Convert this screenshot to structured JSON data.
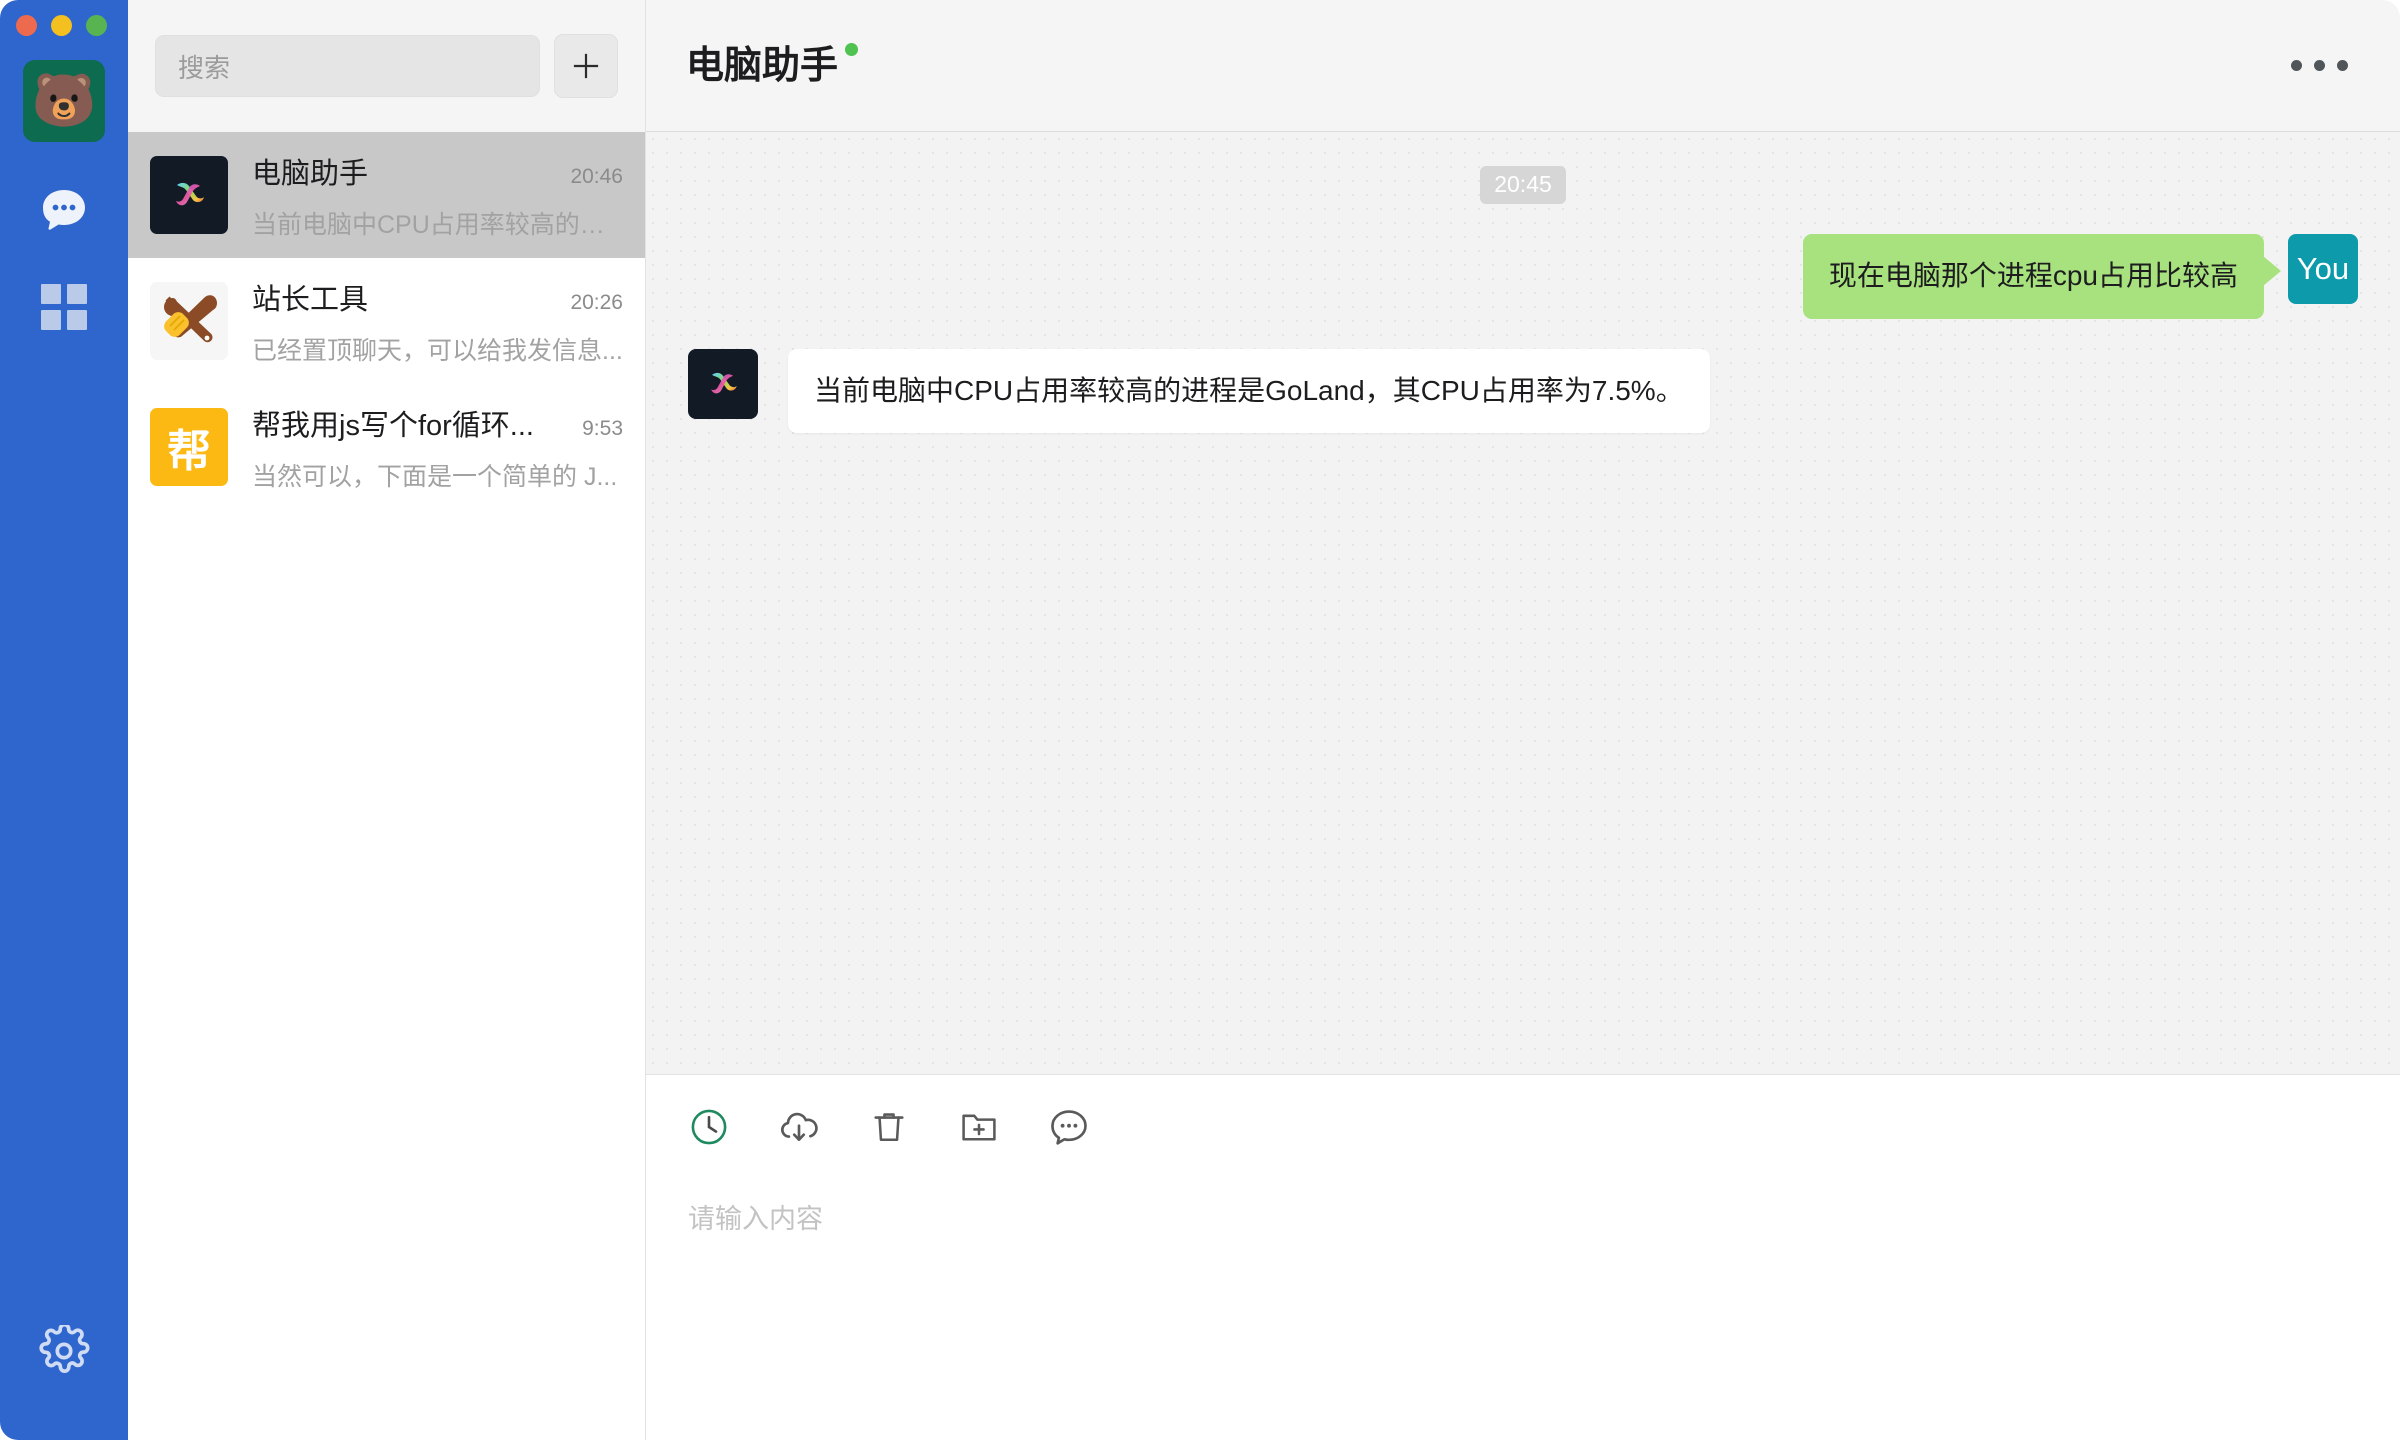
{
  "window": {
    "traffic_lights": [
      {
        "name": "close",
        "color": "#ee6a4e"
      },
      {
        "name": "minimize",
        "color": "#f4c020"
      },
      {
        "name": "zoom",
        "color": "#58b451"
      }
    ]
  },
  "rail": {
    "account_avatar_glyph": "🐻",
    "items": [
      {
        "name": "chats",
        "icon": "chat-bubble-icon",
        "active": true
      },
      {
        "name": "apps",
        "icon": "grid-icon",
        "active": false
      }
    ],
    "settings": {
      "icon": "gear-icon",
      "label": "设置"
    }
  },
  "search": {
    "placeholder": "搜索",
    "value": "",
    "add_button_label": "+"
  },
  "chat_list": [
    {
      "avatar_type": "copilot",
      "avatar_text": "",
      "title": "电脑助手",
      "time": "20:46",
      "preview": "当前电脑中CPU占用率较高的进...",
      "active": true
    },
    {
      "avatar_type": "tools",
      "avatar_text": "🛠",
      "title": "站长工具",
      "time": "20:26",
      "preview": "已经置顶聊天，可以给我发信息...",
      "active": false
    },
    {
      "avatar_type": "letter",
      "avatar_text": "帮",
      "title": "帮我用js写个for循环...",
      "time": "9:53",
      "preview": "当然可以，下面是一个简单的 J...",
      "active": false
    }
  ],
  "conversation": {
    "title": "电脑助手",
    "online": true,
    "online_color": "#4fc24f",
    "more_menu_label": "···",
    "timestamp_divider": "20:45",
    "messages": [
      {
        "side": "out",
        "avatar_label": "You",
        "avatar_color": "#0d9aab",
        "bubble_color": "#a8e27f",
        "text": "现在电脑那个进程cpu占用比较高"
      },
      {
        "side": "in",
        "avatar_label": "",
        "avatar_color": "#121a26",
        "bubble_color": "#ffffff",
        "text": "当前电脑中CPU占用率较高的进程是GoLand，其CPU占用率为7.5%。"
      }
    ]
  },
  "composer": {
    "tools": [
      {
        "name": "history-clock-icon",
        "label": "历史记录",
        "accent": "#1f8a5f"
      },
      {
        "name": "cloud-download-icon",
        "label": "下载"
      },
      {
        "name": "trash-icon",
        "label": "清空"
      },
      {
        "name": "folder-add-icon",
        "label": "新建文件夹"
      },
      {
        "name": "chat-dots-icon",
        "label": "更多"
      }
    ],
    "input_placeholder": "请输入内容",
    "input_value": ""
  },
  "colors": {
    "rail_bg": "#2f66cd",
    "active_row": "#c8c8c8",
    "accent_teal": "#0d9aab",
    "bubble_green": "#a8e27f",
    "panel_bg": "#f5f5f5"
  }
}
